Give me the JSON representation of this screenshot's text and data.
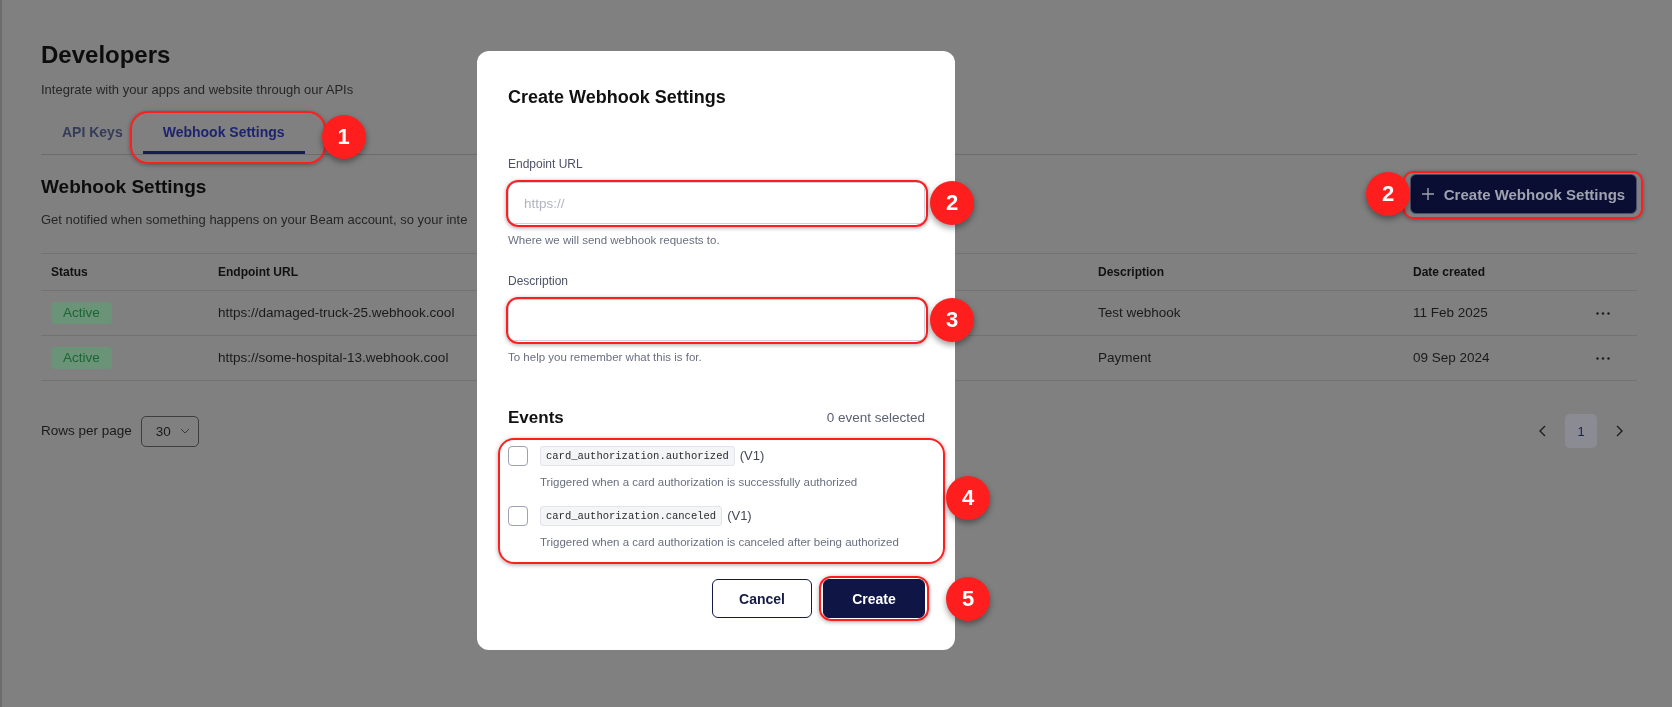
{
  "page": {
    "title": "Developers",
    "subtitle": "Integrate with your apps and website through our APIs"
  },
  "tabs": [
    {
      "label": "API Keys",
      "selected": false
    },
    {
      "label": "Webhook Settings",
      "selected": true,
      "callout": "1"
    }
  ],
  "section": {
    "title": "Webhook Settings",
    "description": "Get notified when something happens on your Beam account, so your inte",
    "create_button": {
      "label": "Create Webhook Settings",
      "callout": "2"
    }
  },
  "table": {
    "columns": [
      "Status",
      "Endpoint URL",
      "Description",
      "Date created"
    ],
    "rows": [
      {
        "status": "Active",
        "endpoint_url": "https://damaged-truck-25.webhook.cool",
        "description": "Test webhook",
        "date_created": "11 Feb 2025"
      },
      {
        "status": "Active",
        "endpoint_url": "https://some-hospital-13.webhook.cool",
        "description": "Payment",
        "date_created": "09 Sep 2024"
      }
    ]
  },
  "pagination": {
    "rows_per_page_label": "Rows per page",
    "rows_per_page": "30",
    "pages": [
      {
        "label": "1",
        "selected": true
      }
    ]
  },
  "dialog": {
    "title": "Create Webhook Settings",
    "fields": [
      {
        "label": "Endpoint URL",
        "placeholder": "https://",
        "hint": "Where we will send webhook requests to.",
        "callout": "2"
      },
      {
        "label": "Description",
        "hint": "To help you remember what this is for.",
        "callout": "3"
      }
    ],
    "events_title": "Events",
    "events_count": "0 event selected",
    "events_callout": "4",
    "events": [
      {
        "name": "card_authorization.authorized",
        "version": "(V1)",
        "description": "Triggered when a card authorization is successfully authorized",
        "checked": false
      },
      {
        "name": "card_authorization.canceled",
        "version": "(V1)",
        "description": "Triggered when a card authorization is canceled after being authorized",
        "checked": false
      }
    ],
    "buttons": [
      {
        "label": "Cancel",
        "kind": "secondary"
      },
      {
        "label": "Create",
        "kind": "primary",
        "callout": "5"
      }
    ]
  }
}
